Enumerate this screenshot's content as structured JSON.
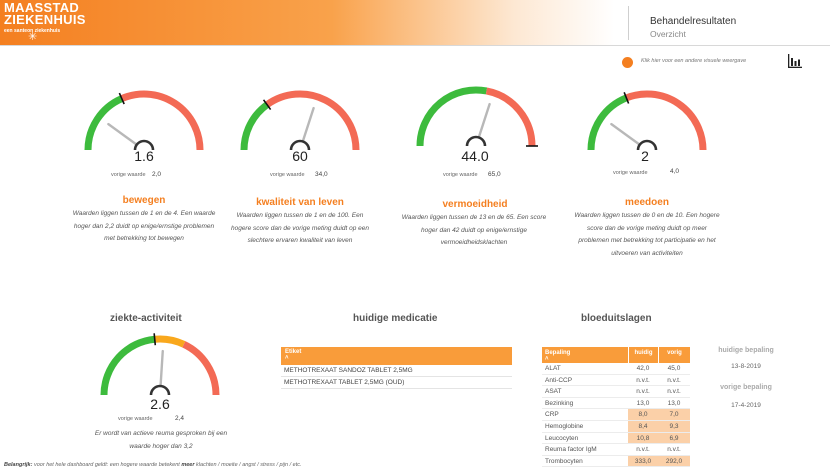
{
  "header": {
    "logo_line1": "MAASSTAD",
    "logo_line2": "ZIEKENHUIS",
    "logo_sub": "een santeon ziekenhuis",
    "title": "Behandelresultaten",
    "subtitle": "Overzicht"
  },
  "toolbar": {
    "toggle_text": "Klik hier voor een andere visuele weergave"
  },
  "gauges": [
    {
      "value": "1.6",
      "value_num": 1.6,
      "min": 1,
      "max": 4,
      "cutoff": 2.2,
      "needle_frac": 0.2,
      "prev_label": "vorige waarde",
      "prev_value": "2,0",
      "title": "bewegen",
      "description": "Waarden liggen tussen de 1 en de  4. Een waarde hoger dan 2,2 duidt op enige/ernstige problemen met betrekking tot bewegen"
    },
    {
      "value": "60",
      "value_num": 60,
      "min": 1,
      "max": 100,
      "cutoff": 34,
      "needle_frac": 0.6,
      "prev_label": "vorige waarde",
      "prev_value": "34,0",
      "title": "kwaliteit van leven",
      "description": "Waarden liggen tussen de 1 en de 100. Een hogere score dan de vorige meting duidt op een slechtere ervaren kwaliteit van leven"
    },
    {
      "value": "44.0",
      "value_num": 44,
      "min": 13,
      "max": 65,
      "cutoff": 42,
      "needle_frac": 0.6,
      "prev_label": "vorige waarde",
      "prev_value": "65,0",
      "title": "vermoeidheid",
      "description": "Waarden liggen tussen de 13 en de 65. Een score hoger dan 42 duidt op enige/ernstige vermoeidheidsklachten"
    },
    {
      "value": "2",
      "value_num": 2,
      "min": 0,
      "max": 10,
      "cutoff": 4,
      "needle_frac": 0.2,
      "prev_label": "vorige waarde",
      "prev_value": "4,0",
      "title": "meedoen",
      "description": "Waarden liggen tussen de 0 en de 10. Een hogere score dan de vorige meting duidt op meer problemen met betrekking tot participatie en het uitvoeren van activiteiten"
    }
  ],
  "ziekte": {
    "title": "ziekte-activiteit",
    "value": "2.6",
    "needle_frac": 0.52,
    "prev_label": "vorige waarde",
    "prev_value": "2,4",
    "description": "Er wordt van actieve reuma gesproken bij een waarde hoger dan 3,2"
  },
  "medicatie": {
    "title": "huidige medicatie",
    "column": "Etiket",
    "rows": [
      "METHOTREXAAT SANDOZ TABLET 2,5MG",
      "METHOTREXAAT TABLET 2,5MG (OUD)"
    ]
  },
  "bloed": {
    "title": "bloeduitslagen",
    "columns": [
      "Bepaling",
      "huidig",
      "vorig"
    ],
    "rows": [
      {
        "name": "ALAT",
        "huidig": "42,0",
        "vorig": "45,0",
        "hl": false
      },
      {
        "name": "Anti-CCP",
        "huidig": "n.v.t.",
        "vorig": "n.v.t.",
        "hl": false
      },
      {
        "name": "ASAT",
        "huidig": "n.v.t.",
        "vorig": "n.v.t.",
        "hl": false
      },
      {
        "name": "Bezinking",
        "huidig": "13,0",
        "vorig": "13,0",
        "hl": false
      },
      {
        "name": "CRP",
        "huidig": "8,0",
        "vorig": "7,0",
        "hl": true
      },
      {
        "name": "Hemoglobine",
        "huidig": "8,4",
        "vorig": "9,3",
        "hl": true
      },
      {
        "name": "Leucocyten",
        "huidig": "10,8",
        "vorig": "6,9",
        "hl": true
      },
      {
        "name": "Reuma factor IgM",
        "huidig": "n.v.t.",
        "vorig": "n.v.t.",
        "hl": false
      },
      {
        "name": "Trombocyten",
        "huidig": "333,0",
        "vorig": "292,0",
        "hl": true
      }
    ],
    "huidige_label": "huidige bepaling",
    "huidige_date": "13-8-2019",
    "vorige_label": "vorige bepaling",
    "vorige_date": "17-4-2019"
  },
  "footnote": {
    "bold1": "Belangrijk:",
    "text1": " voor het hele dashboard geldt: een hogere waarde betekent ",
    "bold2": "meer",
    "text2": " klachten / moeite / angst / stress / pijn / etc."
  },
  "colors": {
    "accent": "#f47f20",
    "good": "#3dbb3d",
    "bad": "#f36a55",
    "warn": "#f9a81d",
    "needle": "#b8b8b8"
  }
}
